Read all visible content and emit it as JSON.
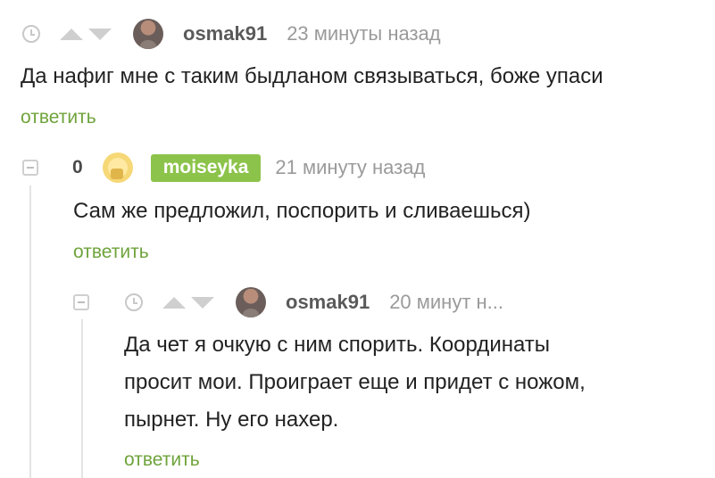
{
  "comments": [
    {
      "username": "osmak91",
      "time": "23 минуты назад",
      "text": "Да нафиг мне с таким быдланом связываться, боже упаси",
      "reply_label": "ответить"
    },
    {
      "rating": "0",
      "username": "moiseyka",
      "time": "21 минуту назад",
      "text": "Сам же предложил, поспорить и сливаешься)",
      "reply_label": "ответить"
    },
    {
      "username": "osmak91",
      "time": "20 минут н...",
      "text_lines": [
        "Да чет я очкую с ним спорить. Координаты",
        "просит мои. Проиграет еще и придет с ножом,",
        "пырнет. Ну его нахер."
      ],
      "reply_label": "ответить"
    }
  ],
  "colors": {
    "accent": "#6fa33b",
    "badge_bg": "#8cc34a",
    "muted": "#9a9a9a"
  }
}
